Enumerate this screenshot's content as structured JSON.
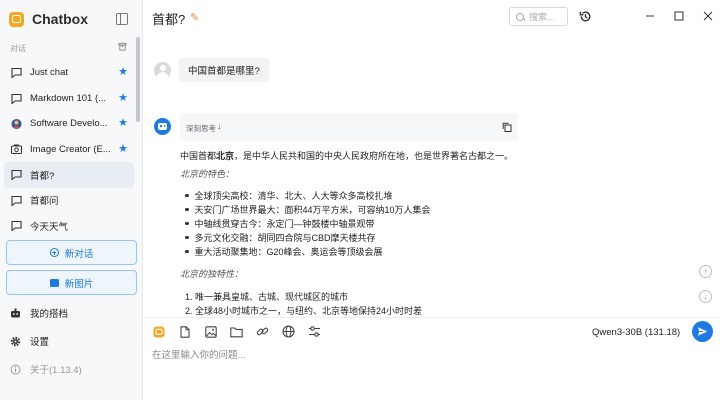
{
  "app": {
    "name": "Chatbox",
    "accent_color": "#1f7ae0",
    "logo_color": "#f5a623"
  },
  "sidebar": {
    "section_label": "对话",
    "conversations": [
      {
        "title": "Just chat",
        "icon": "chat-bubble-icon",
        "starred": true,
        "active": false
      },
      {
        "title": "Markdown 101 (...",
        "icon": "chat-bubble-icon",
        "starred": true,
        "active": false
      },
      {
        "title": "Software Develo...",
        "icon": "developer-avatar-icon",
        "starred": true,
        "active": false
      },
      {
        "title": "Image Creator (E...",
        "icon": "image-creator-icon",
        "starred": true,
        "active": false
      },
      {
        "title": "首都?",
        "icon": "chat-bubble-icon",
        "starred": false,
        "active": true
      },
      {
        "title": "首都问",
        "icon": "chat-bubble-icon",
        "starred": false,
        "active": false
      },
      {
        "title": "今天天气",
        "icon": "chat-bubble-icon",
        "starred": false,
        "active": false
      }
    ],
    "new_chat_label": "新对话",
    "new_image_label": "新图片",
    "my_copilots_label": "我的搭档",
    "settings_label": "设置",
    "about_label": "关于(1.13.4)"
  },
  "header": {
    "title": "首都?",
    "search_placeholder": "搜索..."
  },
  "conversation": {
    "user_message": "中国首都是哪里?",
    "reasoning_label": "深刻思考",
    "reasoning_toggle": "↓",
    "answer": {
      "intro_prefix": "中国首都",
      "intro_bold": "北京",
      "intro_suffix": "，是中华人民共和国的中央人民政府所在地，也是世界著名古都之一。",
      "heading_features": "北京的特色：",
      "features": [
        "全球顶尖高校：清华、北大、人大等众多高校扎堆",
        "天安门广场世界最大：面积44万平方米，可容纳10万人集会",
        "中轴线贯穿古今：永定门—钟鼓楼中轴景观带",
        "多元文化交融：胡同四合院与CBD摩天楼共存",
        "重大活动聚集地：G20峰会、奥运会等顶级会展"
      ],
      "heading_unique": "北京的独特性：",
      "unique": [
        "1. 唯一兼具皇城、古城、现代城区的城市",
        "2. 全球48小时城市之一，与纽约、北京等地保持24小时时差"
      ]
    }
  },
  "input": {
    "placeholder": "在这里输入你的问题...",
    "model_label": "Qwen3-30B (131.18)"
  }
}
